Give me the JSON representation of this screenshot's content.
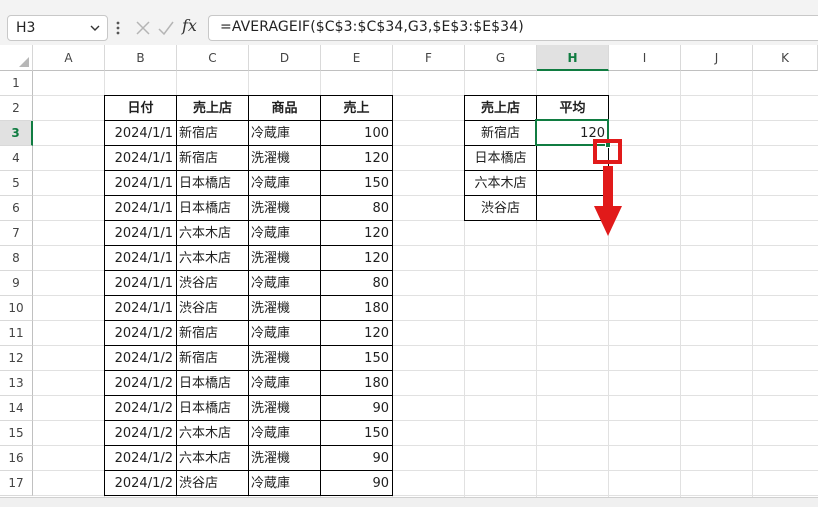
{
  "name_box": {
    "value": "H3"
  },
  "formula_bar": {
    "fx_label": "fx",
    "formula": "=AVERAGEIF($C$3:$C$34,G3,$E$3:$E$34)"
  },
  "columns": [
    "A",
    "B",
    "C",
    "D",
    "E",
    "F",
    "G",
    "H",
    "I",
    "J",
    "K"
  ],
  "rows": [
    "1",
    "2",
    "3",
    "4",
    "5",
    "6",
    "7",
    "8",
    "9",
    "10",
    "11",
    "12",
    "13",
    "14",
    "15",
    "16",
    "17"
  ],
  "selected_cell": {
    "column": "H",
    "row": "3"
  },
  "sales_table": {
    "headers": [
      "日付",
      "売上店",
      "商品",
      "売上"
    ],
    "rows": [
      [
        "2024/1/1",
        "新宿店",
        "冷蔵庫",
        "100"
      ],
      [
        "2024/1/1",
        "新宿店",
        "洗濯機",
        "120"
      ],
      [
        "2024/1/1",
        "日本橋店",
        "冷蔵庫",
        "150"
      ],
      [
        "2024/1/1",
        "日本橋店",
        "洗濯機",
        "80"
      ],
      [
        "2024/1/1",
        "六本木店",
        "冷蔵庫",
        "120"
      ],
      [
        "2024/1/1",
        "六本木店",
        "洗濯機",
        "120"
      ],
      [
        "2024/1/1",
        "渋谷店",
        "冷蔵庫",
        "80"
      ],
      [
        "2024/1/1",
        "渋谷店",
        "洗濯機",
        "180"
      ],
      [
        "2024/1/2",
        "新宿店",
        "冷蔵庫",
        "120"
      ],
      [
        "2024/1/2",
        "新宿店",
        "洗濯機",
        "150"
      ],
      [
        "2024/1/2",
        "日本橋店",
        "冷蔵庫",
        "180"
      ],
      [
        "2024/1/2",
        "日本橋店",
        "洗濯機",
        "90"
      ],
      [
        "2024/1/2",
        "六本木店",
        "冷蔵庫",
        "150"
      ],
      [
        "2024/1/2",
        "六本木店",
        "洗濯機",
        "90"
      ],
      [
        "2024/1/2",
        "渋谷店",
        "冷蔵庫",
        "90"
      ]
    ]
  },
  "summary_table": {
    "headers": [
      "売上店",
      "平均"
    ],
    "rows": [
      [
        "新宿店",
        "120"
      ],
      [
        "日本橋店",
        ""
      ],
      [
        "六本木店",
        ""
      ],
      [
        "渋谷店",
        ""
      ]
    ]
  },
  "annotation": {
    "highlight_color": "#e11a1a",
    "arrow_icon": "arrow-down-icon"
  },
  "accent_color": "#107c41"
}
